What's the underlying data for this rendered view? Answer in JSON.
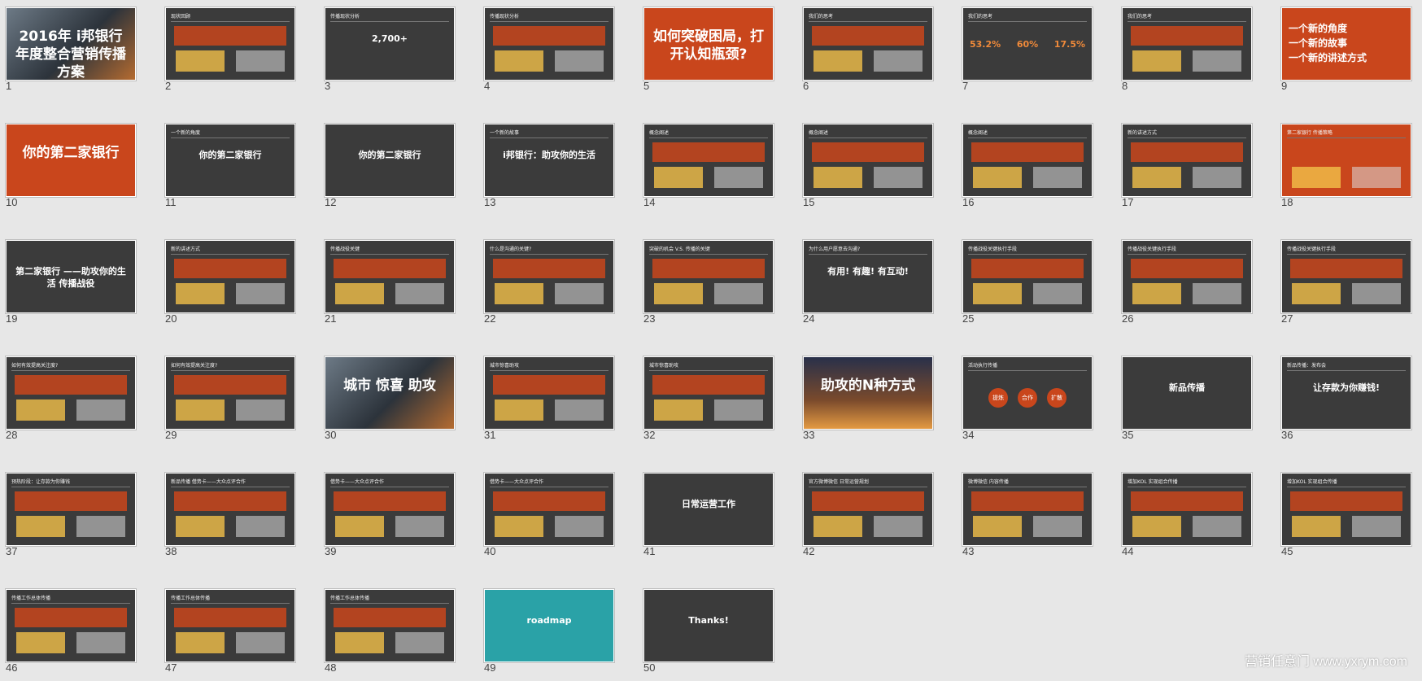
{
  "watermark": "营销任意门 www.yxrym.com",
  "slides": [
    {
      "n": "1",
      "style": "photo",
      "title": "2016年 i邦银行年度整合营销传播方案"
    },
    {
      "n": "2",
      "style": "dark",
      "header": "现状回顾"
    },
    {
      "n": "3",
      "style": "dark",
      "header": "传播现状分析",
      "title": "2,700+"
    },
    {
      "n": "4",
      "style": "dark",
      "header": "传播现状分析"
    },
    {
      "n": "5",
      "style": "orange",
      "title": "如何突破困局，打开认知瓶颈?"
    },
    {
      "n": "6",
      "style": "dark",
      "header": "我们的思考"
    },
    {
      "n": "7",
      "style": "dark",
      "header": "我们的思考",
      "stats": [
        "53.2%",
        "60%",
        "17.5%"
      ]
    },
    {
      "n": "8",
      "style": "dark",
      "header": "我们的思考"
    },
    {
      "n": "9",
      "style": "orange",
      "lines": [
        "一个新的角度",
        "一个新的故事",
        "一个新的讲述方式"
      ]
    },
    {
      "n": "10",
      "style": "orange",
      "title": "你的第二家银行"
    },
    {
      "n": "11",
      "style": "dark",
      "header": "一个新的角度",
      "title": "你的第二家银行"
    },
    {
      "n": "12",
      "style": "dark",
      "title": "你的第二家银行"
    },
    {
      "n": "13",
      "style": "dark",
      "header": "一个新的故事",
      "title": "i邦银行：助攻你的生活"
    },
    {
      "n": "14",
      "style": "dark",
      "header": "概念阐述"
    },
    {
      "n": "15",
      "style": "dark",
      "header": "概念阐述"
    },
    {
      "n": "16",
      "style": "dark",
      "header": "概念阐述"
    },
    {
      "n": "17",
      "style": "dark",
      "header": "新的讲述方式"
    },
    {
      "n": "18",
      "style": "orange",
      "header": "第二家银行  传播策略"
    },
    {
      "n": "19",
      "style": "dark",
      "title": "第二家银行 ——助攻你的生活 传播战役"
    },
    {
      "n": "20",
      "style": "dark",
      "header": "新的讲述方式"
    },
    {
      "n": "21",
      "style": "dark",
      "header": "传播战役关键"
    },
    {
      "n": "22",
      "style": "dark",
      "header": "什么是沟通的关键?"
    },
    {
      "n": "23",
      "style": "dark",
      "header": "突破的机会 V.S. 传播的关键"
    },
    {
      "n": "24",
      "style": "dark",
      "header": "为什么用户愿意去沟通?",
      "title": "有用! 有趣! 有互动!"
    },
    {
      "n": "25",
      "style": "dark",
      "header": "传播战役关键执行手段"
    },
    {
      "n": "26",
      "style": "dark",
      "header": "传播战役关键执行手段"
    },
    {
      "n": "27",
      "style": "dark",
      "header": "传播战役关键执行手段"
    },
    {
      "n": "28",
      "style": "dark",
      "header": "如何有效提高关注度?"
    },
    {
      "n": "29",
      "style": "dark",
      "header": "如何有效提高关注度?"
    },
    {
      "n": "30",
      "style": "photo",
      "title": "城市 惊喜 助攻"
    },
    {
      "n": "31",
      "style": "dark",
      "header": "城市惊喜助攻"
    },
    {
      "n": "32",
      "style": "dark",
      "header": "城市惊喜助攻"
    },
    {
      "n": "33",
      "style": "city",
      "title": "助攻的N种方式"
    },
    {
      "n": "34",
      "style": "dark",
      "header": "活动执行传播",
      "circles": [
        "提炼",
        "合作",
        "扩散"
      ]
    },
    {
      "n": "35",
      "style": "dark",
      "title": "新品传播"
    },
    {
      "n": "36",
      "style": "dark",
      "header": "新品传播：发布会",
      "title": "让存款为你赚钱!"
    },
    {
      "n": "37",
      "style": "dark",
      "header": "预热阶段：让存款为你赚钱"
    },
    {
      "n": "38",
      "style": "dark",
      "header": "新品传播 借势卡——大众点评合作"
    },
    {
      "n": "39",
      "style": "dark",
      "header": "借势卡——大众点评合作"
    },
    {
      "n": "40",
      "style": "dark",
      "header": "借势卡——大众点评合作"
    },
    {
      "n": "41",
      "style": "dark",
      "title": "日常运营工作"
    },
    {
      "n": "42",
      "style": "dark",
      "header": "官方微博微信 日常运营规划"
    },
    {
      "n": "43",
      "style": "dark",
      "header": "微博微信 内容传播"
    },
    {
      "n": "44",
      "style": "dark",
      "header": "增加KOL 实现组合传播"
    },
    {
      "n": "45",
      "style": "dark",
      "header": "增加KOL 实现组合传播"
    },
    {
      "n": "46",
      "style": "dark",
      "header": "传播工作总体传播"
    },
    {
      "n": "47",
      "style": "dark",
      "header": "传播工作总体传播"
    },
    {
      "n": "48",
      "style": "dark",
      "header": "传播工作总体传播"
    },
    {
      "n": "49",
      "style": "roadmap",
      "title": "roadmap"
    },
    {
      "n": "50",
      "style": "dark",
      "title": "Thanks!"
    }
  ]
}
